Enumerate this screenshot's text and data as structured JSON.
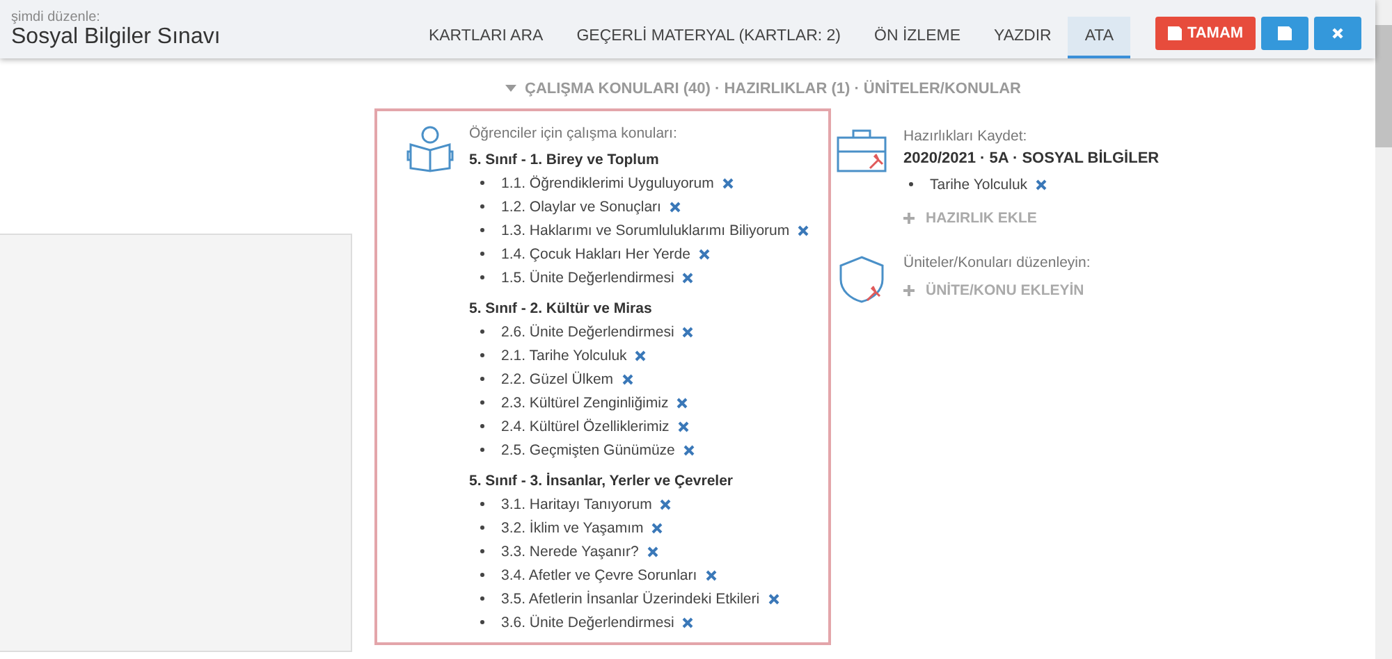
{
  "header": {
    "subtitle": "şimdi düzenle:",
    "title": "Sosyal Bilgiler Sınavı"
  },
  "tabs": [
    {
      "label": "KARTLARI ARA",
      "selected": false
    },
    {
      "label": "GEÇERLİ MATERYAL (KARTLAR: 2)",
      "selected": false
    },
    {
      "label": "ÖN İZLEME",
      "selected": false
    },
    {
      "label": "YAZDIR",
      "selected": false
    },
    {
      "label": "ATA",
      "selected": true
    }
  ],
  "actions": [
    {
      "kind": "done",
      "label": "TAMAM"
    },
    {
      "kind": "save"
    },
    {
      "kind": "close"
    }
  ],
  "section_toggle": {
    "label": "ÇALIŞMA KONULARI (40) · HAZIRLIKLAR (1) · ÜNİTELER/KONULAR",
    "expanded": true
  },
  "topics": {
    "caption": "Öğrenciler için çalışma konuları:",
    "groups": [
      {
        "title": "5. Sınıf - 1. Birey ve Toplum",
        "items": [
          "1.1. Öğrendiklerimi Uyguluyorum",
          "1.2. Olaylar ve Sonuçları",
          "1.3. Haklarımı ve Sorumluluklarımı Biliyorum",
          "1.4. Çocuk Hakları Her Yerde",
          "1.5. Ünite Değerlendirmesi"
        ]
      },
      {
        "title": "5. Sınıf - 2. Kültür ve Miras",
        "items": [
          "2.6. Ünite Değerlendirmesi",
          "2.1. Tarihe Yolculuk",
          "2.2. Güzel Ülkem",
          "2.3. Kültürel Zenginliğimiz",
          "2.4. Kültürel Özelliklerimiz",
          "2.5. Geçmişten Günümüze"
        ]
      },
      {
        "title": "5. Sınıf - 3. İnsanlar, Yerler ve Çevreler",
        "items": [
          "3.1. Haritayı Tanıyorum",
          "3.2. İklim ve Yaşamım",
          "3.3. Nerede Yaşanır?",
          "3.4. Afetler ve Çevre Sorunları",
          "3.5. Afetlerin İnsanlar Üzerindeki Etkileri",
          "3.6. Ünite Değerlendirmesi"
        ]
      }
    ]
  },
  "preparations": {
    "caption": "Hazırlıkları Kaydet:",
    "course": "2020/2021 · 5A · SOSYAL BİLGİLER",
    "items": [
      "Tarihe Yolculuk"
    ],
    "add_label": "HAZIRLIK EKLE"
  },
  "units": {
    "caption": "Üniteler/Konuları düzenleyin:",
    "add_label": "ÜNİTE/KONU EKLEYİN"
  }
}
